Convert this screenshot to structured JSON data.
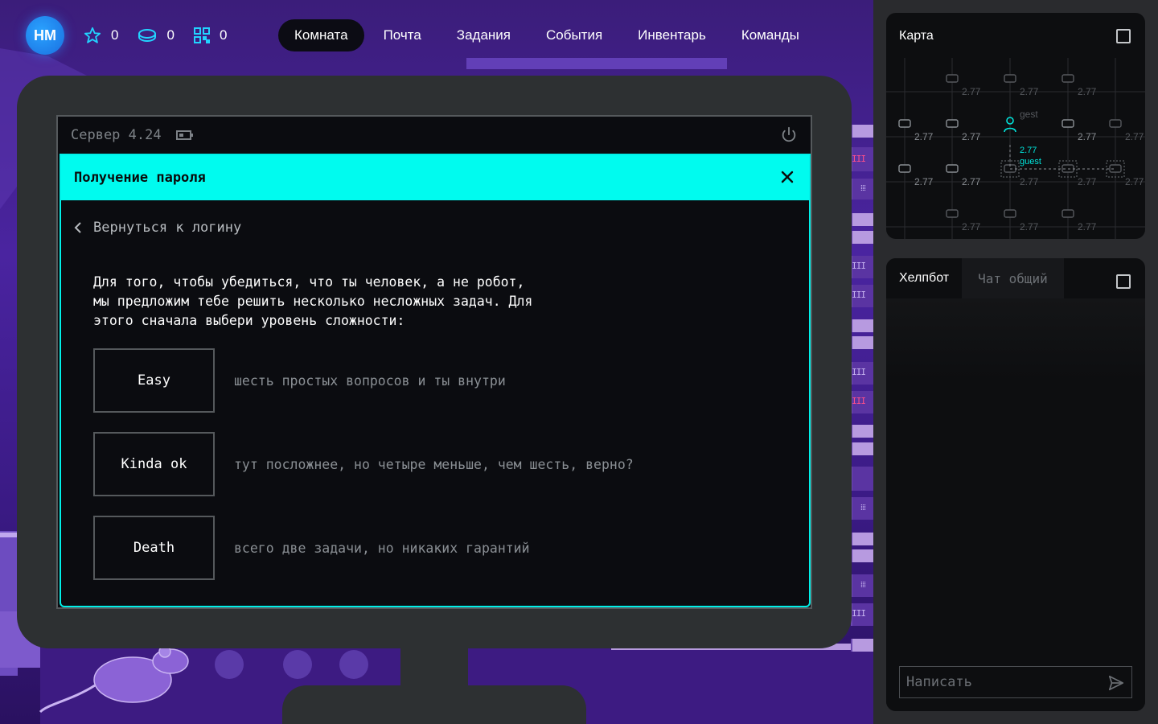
{
  "user": {
    "initials": "HM"
  },
  "stats": [
    {
      "icon": "star-icon",
      "value": "0"
    },
    {
      "icon": "coin-icon",
      "value": "0"
    },
    {
      "icon": "qr-icon",
      "value": "0"
    }
  ],
  "menu": [
    {
      "label": "Комната",
      "active": true
    },
    {
      "label": "Почта",
      "active": false
    },
    {
      "label": "Задания",
      "active": false
    },
    {
      "label": "События",
      "active": false
    },
    {
      "label": "Инвентарь",
      "active": false
    },
    {
      "label": "Команды",
      "active": false
    }
  ],
  "screen": {
    "server_label": "Сервер 4.24",
    "dialog": {
      "title": "Получение пароля",
      "back_label": "Вернуться к логину",
      "intro_lines": [
        "Для того, чтобы убедиться, что ты человек, а не робот,",
        "мы предложим тебе решить несколько несложных задач. Для",
        "этого сначала выбери уровень сложности:"
      ],
      "levels": [
        {
          "label": "Easy",
          "description": "шесть простых вопросов и ты внутри"
        },
        {
          "label": "Kinda ok",
          "description": "тут посложнее, но четыре меньше, чем шесть, верно?"
        },
        {
          "label": "Death",
          "description": "всего две задачи, но никаких гарантий"
        }
      ]
    }
  },
  "map": {
    "title": "Карта",
    "node_value": "2.77",
    "labels": [
      "gest",
      "guest"
    ]
  },
  "chat": {
    "tabs": [
      {
        "label": "Хелпбот",
        "active": true
      },
      {
        "label": "Чат общий",
        "active": false
      }
    ],
    "input_placeholder": "Написать"
  },
  "colors": {
    "accent": "#00fbef",
    "background_purple": "#4a24a0",
    "panel": "#0d0e10"
  }
}
